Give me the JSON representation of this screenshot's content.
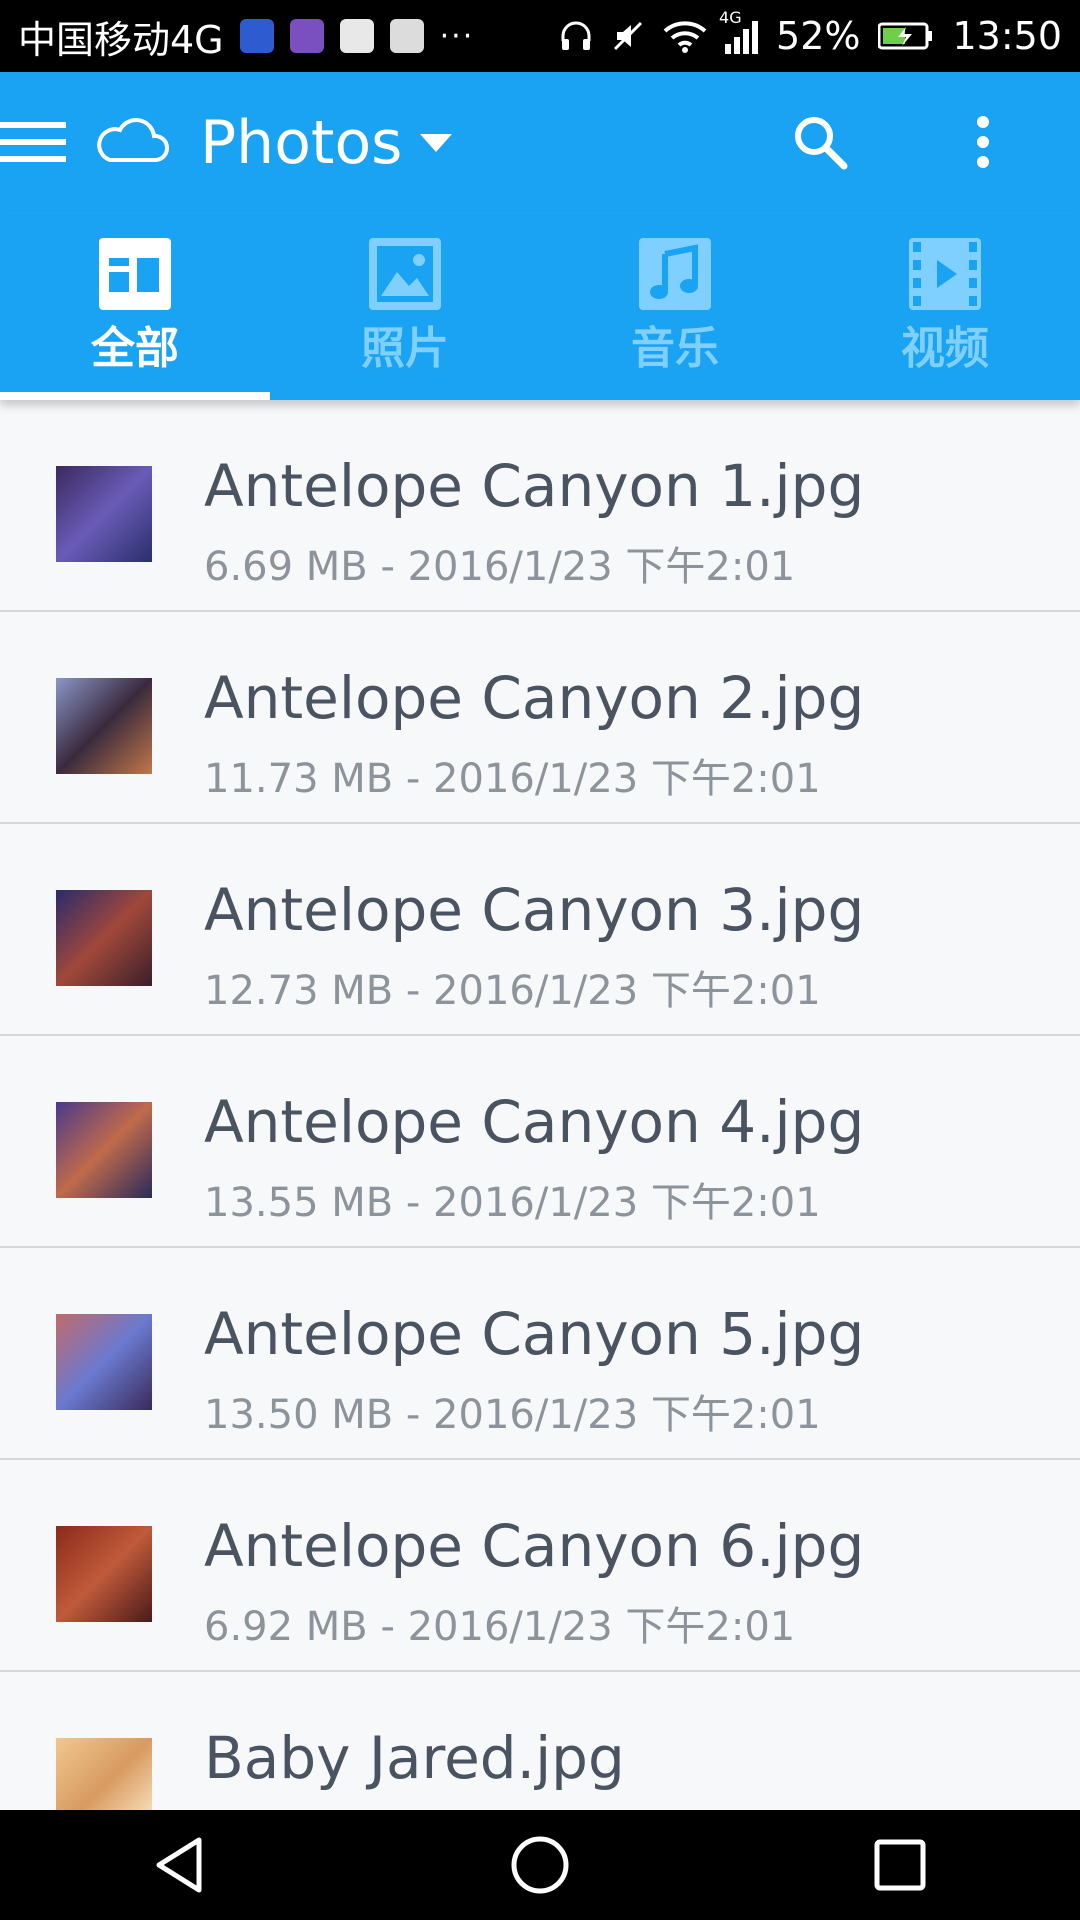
{
  "status_bar": {
    "carrier": "中国移动4G",
    "dots": "···",
    "battery": "52%",
    "time": "13:50",
    "network_badge": "4G"
  },
  "toolbar": {
    "title": "Photos",
    "menu_icon": "hamburger-menu-icon",
    "cloud_icon": "cloud-icon",
    "search_icon": "search-icon",
    "more_icon": "more-vertical-icon"
  },
  "tabs": [
    {
      "label": "全部",
      "icon": "all-grid-icon",
      "active": true
    },
    {
      "label": "照片",
      "icon": "photo-icon",
      "active": false
    },
    {
      "label": "音乐",
      "icon": "music-icon",
      "active": false
    },
    {
      "label": "视频",
      "icon": "video-icon",
      "active": false
    }
  ],
  "files": [
    {
      "name": "Antelope Canyon 1.jpg",
      "meta": "6.69 MB - 2016/1/23 下午2:01",
      "thumb_colors": [
        "#3a2a5e",
        "#6a5bb8",
        "#2a2f6b"
      ]
    },
    {
      "name": "Antelope Canyon 2.jpg",
      "meta": "11.73 MB - 2016/1/23 下午2:01",
      "thumb_colors": [
        "#8a96c8",
        "#3a2a3e",
        "#c0784a"
      ]
    },
    {
      "name": "Antelope Canyon 3.jpg",
      "meta": "12.73 MB - 2016/1/23 下午2:01",
      "thumb_colors": [
        "#2a2b6b",
        "#a0483a",
        "#3b1f2a"
      ]
    },
    {
      "name": "Antelope Canyon 4.jpg",
      "meta": "13.55 MB - 2016/1/23 下午2:01",
      "thumb_colors": [
        "#4a3a8a",
        "#c06a4a",
        "#2a2a5b"
      ]
    },
    {
      "name": "Antelope Canyon 5.jpg",
      "meta": "13.50 MB - 2016/1/23 下午2:01",
      "thumb_colors": [
        "#c06a6a",
        "#6a7ad0",
        "#3a2a5a"
      ]
    },
    {
      "name": "Antelope Canyon 6.jpg",
      "meta": "6.92 MB - 2016/1/23 下午2:01",
      "thumb_colors": [
        "#8a2a1a",
        "#c05a3a",
        "#4a1a1a"
      ]
    },
    {
      "name": "Baby Jared.jpg",
      "meta": "",
      "thumb_colors": [
        "#f0c890",
        "#d89a60",
        "#fff0d0"
      ]
    }
  ],
  "nav": {
    "back_icon": "back-triangle-icon",
    "home_icon": "home-circle-icon",
    "recents_icon": "recents-square-icon"
  },
  "colors": {
    "accent": "#1aa3f2",
    "tab_inactive": "#7fd0ff",
    "text_primary": "#4a5360",
    "text_secondary": "#8c939b"
  }
}
